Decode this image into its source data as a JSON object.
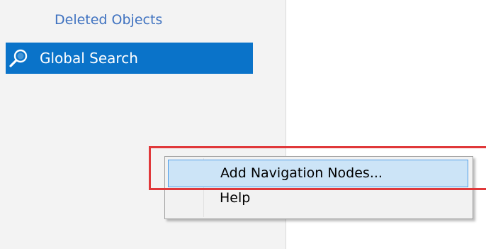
{
  "nav": {
    "deleted_objects": "Deleted Objects",
    "global_search": "Global Search",
    "selected_color": "#0a73c9",
    "link_color": "#3f72c0"
  },
  "context_menu": {
    "items": [
      {
        "label": "Add Navigation Nodes...",
        "state": "hovered"
      },
      {
        "label": "Help",
        "state": "normal"
      }
    ],
    "highlight_color": "#e0383a"
  }
}
